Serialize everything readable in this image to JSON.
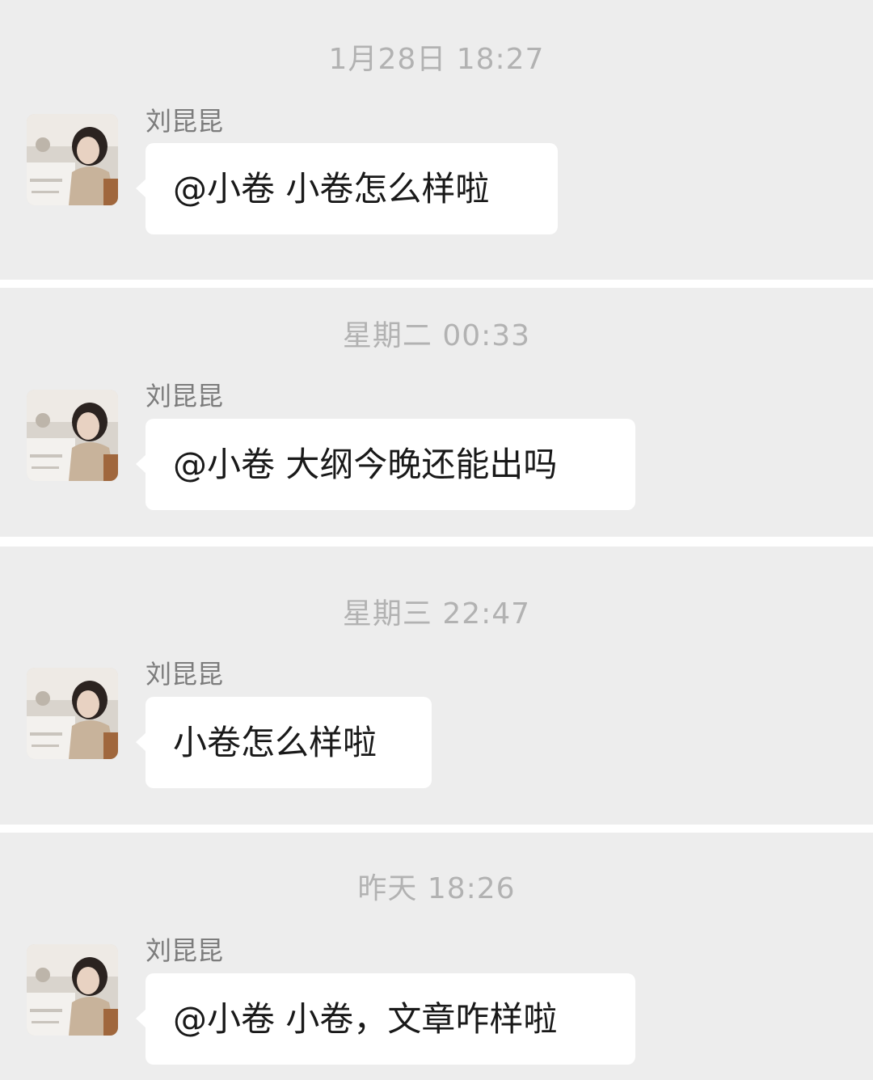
{
  "messages": [
    {
      "timestamp": "1月28日 18:27",
      "sender": "刘昆昆",
      "text": "@小卷 小卷怎么样啦"
    },
    {
      "timestamp": "星期二 00:33",
      "sender": "刘昆昆",
      "text": "@小卷 大纲今晚还能出吗"
    },
    {
      "timestamp": "星期三 22:47",
      "sender": "刘昆昆",
      "text": "小卷怎么样啦"
    },
    {
      "timestamp": "昨天 18:26",
      "sender": "刘昆昆",
      "text": "@小卷 小卷，文章咋样啦"
    }
  ],
  "colors": {
    "panel_background": "#ededed",
    "separator": "#ffffff",
    "bubble": "#ffffff",
    "timestamp_text": "#b2b2b2",
    "sender_text": "#7c7c7c",
    "message_text": "#191919"
  }
}
